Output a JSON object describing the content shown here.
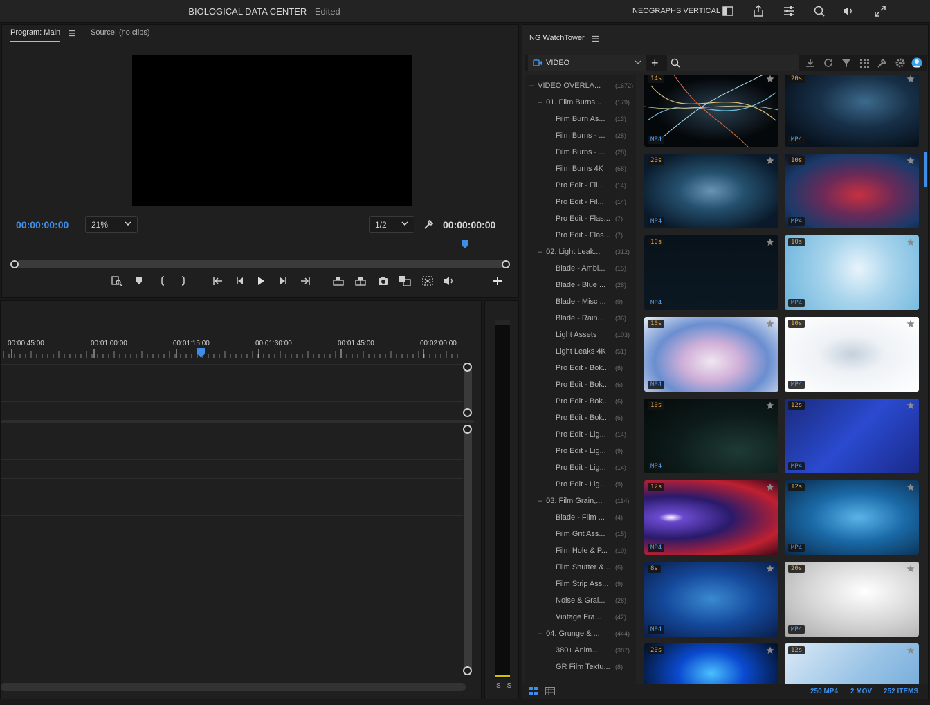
{
  "titlebar": {
    "project": "BIOLOGICAL DATA CENTER",
    "status": " - Edited",
    "workspace": "NEOGRAPHS VERTICAL"
  },
  "program_monitor": {
    "tab_program": "Program: Main",
    "tab_source": "Source: (no clips)",
    "timecode_current": "00:00:00:00",
    "timecode_duration": "00:00:00:00",
    "zoom": "21%",
    "resolution": "1/2"
  },
  "timeline": {
    "ruler_labels": [
      "00:00:45:00",
      "00:01:00:00",
      "00:01:15:00",
      "00:01:30:00",
      "00:01:45:00",
      "00:02:00:00"
    ]
  },
  "meter": {
    "solo_label": "S S"
  },
  "watchtower": {
    "title": "NG WatchTower",
    "category": "VIDEO",
    "search_placeholder": "",
    "tree": [
      {
        "label": "VIDEO OVERLA...",
        "count": "(1672)",
        "level": 0
      },
      {
        "label": "01. Film Burns...",
        "count": "(179)",
        "level": 1
      },
      {
        "label": "Film Burn As...",
        "count": "(13)",
        "level": 2
      },
      {
        "label": "Film Burns - ...",
        "count": "(28)",
        "level": 2
      },
      {
        "label": "Film Burns - ...",
        "count": "(28)",
        "level": 2
      },
      {
        "label": "Film Burns 4K",
        "count": "(68)",
        "level": 2
      },
      {
        "label": "Pro Edit - Fil...",
        "count": "(14)",
        "level": 2
      },
      {
        "label": "Pro Edit - Fil...",
        "count": "(14)",
        "level": 2
      },
      {
        "label": "Pro Edit - Flas...",
        "count": "(7)",
        "level": 2
      },
      {
        "label": "Pro Edit - Flas...",
        "count": "(7)",
        "level": 2
      },
      {
        "label": "02. Light Leak...",
        "count": "(312)",
        "level": 1
      },
      {
        "label": "Blade - Ambi...",
        "count": "(15)",
        "level": 2
      },
      {
        "label": "Blade - Blue ...",
        "count": "(28)",
        "level": 2
      },
      {
        "label": "Blade - Misc ...",
        "count": "(9)",
        "level": 2
      },
      {
        "label": "Blade - Rain...",
        "count": "(36)",
        "level": 2
      },
      {
        "label": "Light Assets",
        "count": "(103)",
        "level": 2
      },
      {
        "label": "Light Leaks 4K",
        "count": "(51)",
        "level": 2
      },
      {
        "label": "Pro Edit - Bok...",
        "count": "(6)",
        "level": 2
      },
      {
        "label": "Pro Edit - Bok...",
        "count": "(6)",
        "level": 2
      },
      {
        "label": "Pro Edit - Bok...",
        "count": "(6)",
        "level": 2
      },
      {
        "label": "Pro Edit - Bok...",
        "count": "(6)",
        "level": 2
      },
      {
        "label": "Pro Edit - Lig...",
        "count": "(14)",
        "level": 2
      },
      {
        "label": "Pro Edit - Lig...",
        "count": "(9)",
        "level": 2
      },
      {
        "label": "Pro Edit - Lig...",
        "count": "(14)",
        "level": 2
      },
      {
        "label": "Pro Edit - Lig...",
        "count": "(9)",
        "level": 2
      },
      {
        "label": "03. Film Grain,...",
        "count": "(114)",
        "level": 1
      },
      {
        "label": "Blade - Film ...",
        "count": "(4)",
        "level": 2
      },
      {
        "label": "Film Grit Ass...",
        "count": "(15)",
        "level": 2
      },
      {
        "label": "Film Hole & P...",
        "count": "(10)",
        "level": 2
      },
      {
        "label": "Film Shutter &...",
        "count": "(6)",
        "level": 2
      },
      {
        "label": "Film Strip Ass...",
        "count": "(9)",
        "level": 2
      },
      {
        "label": "Noise & Grai...",
        "count": "(28)",
        "level": 2
      },
      {
        "label": "Vintage Fra...",
        "count": "(42)",
        "level": 2
      },
      {
        "label": "04. Grunge & ...",
        "count": "(444)",
        "level": 1
      },
      {
        "label": "380+ Anim...",
        "count": "(387)",
        "level": 2
      },
      {
        "label": "GR Film Textu...",
        "count": "(8)",
        "level": 2
      }
    ],
    "thumbs": [
      {
        "dur": "14s",
        "fmt": "MP4",
        "bg": "radial-gradient(ellipse at 55% 50%, #2b4050 0%, #05080b 60%)",
        "art": "lines"
      },
      {
        "dur": "20s",
        "fmt": "MP4",
        "bg": "radial-gradient(ellipse at 60% 40%, #3d6a8c 0%, #173048 40%, #08121e 80%)",
        "art": "none"
      },
      {
        "dur": "20s",
        "fmt": "MP4",
        "bg": "radial-gradient(ellipse at 50% 50%, #6a94b4 0%, #24506e 35%, #0a1a2a 80%)",
        "art": "none"
      },
      {
        "dur": "10s",
        "fmt": "MP4",
        "bg": "radial-gradient(ellipse at 55% 55%, #c83040 0%, #6a2a58 35%, #1a3a6a 70%, #0a1224 100%)",
        "art": "none"
      },
      {
        "dur": "10s",
        "fmt": "MP4",
        "bg": "linear-gradient(180deg, #08121a 0%, #0b1822 100%)",
        "art": "none"
      },
      {
        "dur": "10s",
        "fmt": "MP4",
        "bg": "radial-gradient(circle at 55% 45%, #e8f4fc 0%, #a8d4ec 40%, #6ab4dc 100%)",
        "art": "none"
      },
      {
        "dur": "10s",
        "fmt": "MP4",
        "bg": "radial-gradient(ellipse at 50% 60%, #f0e6f0 0%, #d0b0d8 30%, #6a8ed0 60%, #e8eef6 100%)",
        "art": "none"
      },
      {
        "dur": "10s",
        "fmt": "MP4",
        "bg": "radial-gradient(ellipse at 50% 50%, #c4d0dc 0%, #eef2f6 35%, #ffffff 100%)",
        "art": "none"
      },
      {
        "dur": "10s",
        "fmt": "MP4",
        "bg": "radial-gradient(ellipse at 70% 70%, #1e3a34 0%, #0c1a18 50%, #050a0a 100%)",
        "art": "none"
      },
      {
        "dur": "12s",
        "fmt": "MP4",
        "bg": "linear-gradient(135deg, #1a2a7a 0%, #2a4ad0 50%, #1a2a8a 100%)",
        "art": "none"
      },
      {
        "dur": "12s",
        "fmt": "MP4",
        "bg": "radial-gradient(ellipse at 20% 50%, #ffffff 0%, #6a4ad0 8%, #2a1a6a 40%, #c02030 75%, #3a0a1a 100%)",
        "art": "none"
      },
      {
        "dur": "12s",
        "fmt": "MP4",
        "bg": "radial-gradient(ellipse at 55% 50%, #5ab4e8 0%, #1a6aa8 45%, #0a2a4a 100%)",
        "art": "none"
      },
      {
        "dur": "8s",
        "fmt": "MP4",
        "bg": "radial-gradient(ellipse at 50% 50%, #3a8ad0 0%, #14489a 50%, #0a1e4a 100%)",
        "art": "none"
      },
      {
        "dur": "20s",
        "fmt": "MP4",
        "bg": "radial-gradient(ellipse at 60% 40%, #ffffff 0%, #d6d6d6 50%, #a8a8a8 100%)",
        "art": "none"
      },
      {
        "dur": "20s",
        "fmt": "MP4",
        "bg": "radial-gradient(ellipse at 50% 40%, #4ac0ff 0%, #0a4ad0 35%, #041430 80%)",
        "art": "none"
      },
      {
        "dur": "12s",
        "fmt": "MP4",
        "bg": "linear-gradient(135deg, #dceaf6 0%, #9ac4e6 50%, #6aa4d6 100%)",
        "art": "none"
      }
    ],
    "footer": {
      "mp4": "250 MP4",
      "mov": "2 MOV",
      "items": "252 ITEMS"
    }
  }
}
